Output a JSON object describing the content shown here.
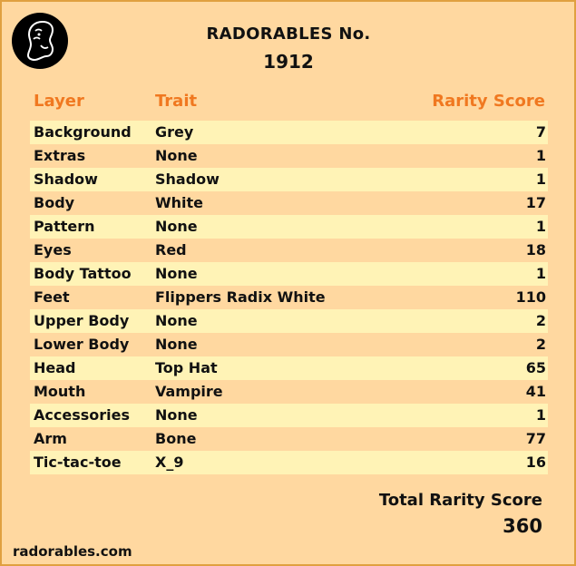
{
  "card": {
    "title": "RADORABLES No.",
    "number": "1912",
    "logo_icon": "radorables-logo-icon"
  },
  "table": {
    "headers": {
      "layer": "Layer",
      "trait": "Trait",
      "score": "Rarity Score"
    },
    "rows": [
      {
        "layer": "Background",
        "trait": "Grey",
        "score": "7"
      },
      {
        "layer": "Extras",
        "trait": "None",
        "score": "1"
      },
      {
        "layer": "Shadow",
        "trait": "Shadow",
        "score": "1"
      },
      {
        "layer": "Body",
        "trait": "White",
        "score": "17"
      },
      {
        "layer": "Pattern",
        "trait": "None",
        "score": "1"
      },
      {
        "layer": "Eyes",
        "trait": "Red",
        "score": "18"
      },
      {
        "layer": "Body Tattoo",
        "trait": "None",
        "score": "1"
      },
      {
        "layer": "Feet",
        "trait": "Flippers Radix White",
        "score": "110"
      },
      {
        "layer": "Upper Body",
        "trait": "None",
        "score": "2"
      },
      {
        "layer": "Lower Body",
        "trait": "None",
        "score": "2"
      },
      {
        "layer": "Head",
        "trait": "Top Hat",
        "score": "65"
      },
      {
        "layer": "Mouth",
        "trait": "Vampire",
        "score": "41"
      },
      {
        "layer": "Accessories",
        "trait": "None",
        "score": "1"
      },
      {
        "layer": "Arm",
        "trait": "Bone",
        "score": "77"
      },
      {
        "layer": "Tic-tac-toe",
        "trait": "X_9",
        "score": "16"
      }
    ]
  },
  "total": {
    "label": "Total Rarity Score",
    "value": "360"
  },
  "footer": {
    "site": "radorables.com"
  },
  "colors": {
    "background": "#ffd8a0",
    "row_highlight": "#fff3b6",
    "header_accent": "#f07820",
    "border": "#e0a040",
    "text": "#111111"
  }
}
